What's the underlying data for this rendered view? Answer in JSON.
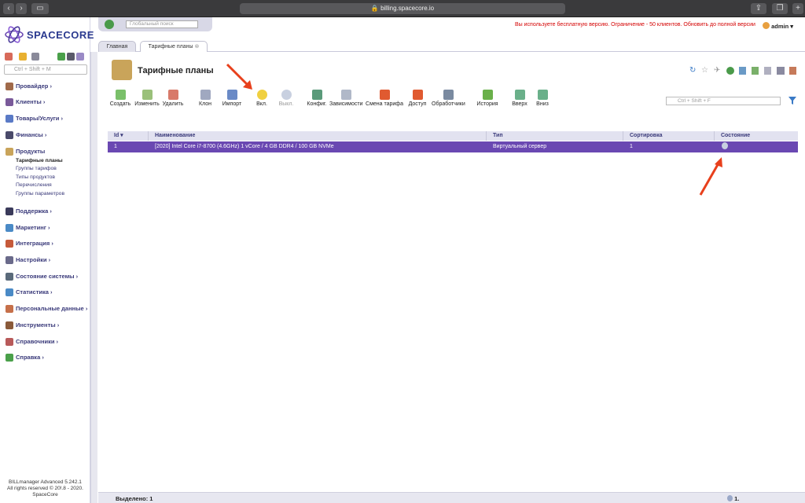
{
  "browser": {
    "url": "billing.spacecore.io"
  },
  "brand": {
    "name": "SPACECORE"
  },
  "sidebar": {
    "search_placeholder": "Ctrl + Shift + M",
    "menu": [
      {
        "label": "Провайдер"
      },
      {
        "label": "Клиенты"
      },
      {
        "label": "Товары/Услуги"
      },
      {
        "label": "Финансы"
      },
      {
        "label": "Продукты"
      },
      {
        "label": "Поддержка"
      },
      {
        "label": "Маркетинг"
      },
      {
        "label": "Интеграция"
      },
      {
        "label": "Настройки"
      },
      {
        "label": "Состояние системы"
      },
      {
        "label": "Статистика"
      },
      {
        "label": "Персональные данные"
      },
      {
        "label": "Инструменты"
      },
      {
        "label": "Справочники"
      },
      {
        "label": "Справка"
      }
    ],
    "submenu": [
      "Тарифные планы",
      "Группы тарифов",
      "Типы продуктов",
      "Перечисления",
      "Группы параметров"
    ],
    "footer": [
      "BILLmanager Advanced 5.242.1",
      "All rights reserved © 20!.8 - 2020.",
      "SpaceCore"
    ]
  },
  "header": {
    "global_search_placeholder": "Глобальный поиск",
    "warning": "Вы используете бесплатную версию. Ограничение - 50 клиентов. Обновить до полной версии",
    "user": "admin"
  },
  "tabs": [
    {
      "label": "Главная"
    },
    {
      "label": "Тарифные планы"
    }
  ],
  "page": {
    "title": "Тарифные планы"
  },
  "toolbar": {
    "buttons": [
      "Создать",
      "Изменить",
      "Удалить",
      "Клон",
      "Импорт",
      "Вкл.",
      "Выкл.",
      "Конфиг.",
      "Зависимости",
      "Смена тарифа",
      "Доступ",
      "Обработчики",
      "История",
      "Вверх",
      "Вниз"
    ]
  },
  "filter": {
    "placeholder": "Ctrl + Shift + F"
  },
  "table": {
    "columns": [
      "Id",
      "Наименование",
      "Тип",
      "Сортировка",
      "Состояние"
    ],
    "rows": [
      {
        "id": "1",
        "name": "[2020] Intel Core i7-8700 (4.6GHz) 1 vCore / 4 GB DDR4 / 100 GB NVMe",
        "type": "Виртуальный сервер",
        "sort": "1"
      }
    ]
  },
  "statusbar": {
    "selected": "Выделено: 1",
    "count": "1."
  },
  "colors": {
    "accent": "#6a48b2",
    "warning": "#d40000",
    "arrow": "#e8401c"
  }
}
